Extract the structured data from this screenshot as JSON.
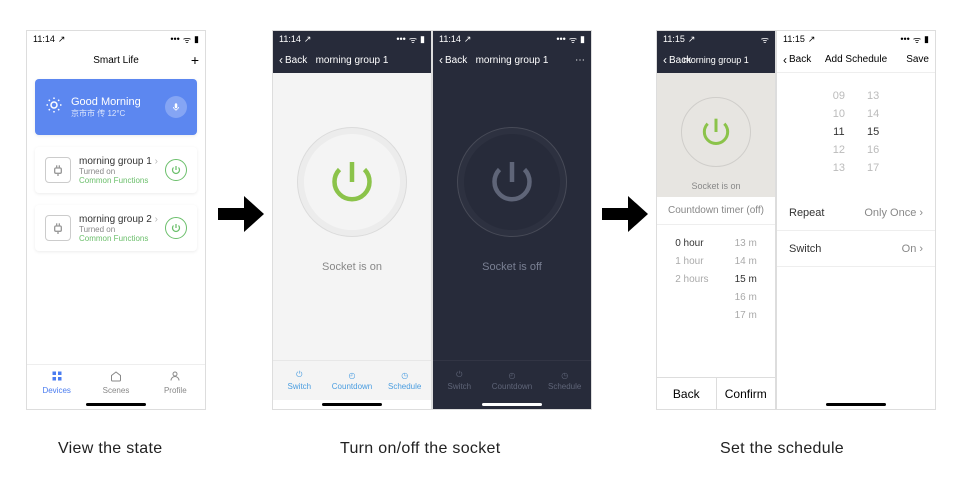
{
  "status_time_a": "11:14",
  "status_time_b": "11:15",
  "stage1": {
    "app_title": "Smart Life",
    "add_icon": "+",
    "weather": {
      "title": "Good Morning",
      "sub": "京市市 传 12°C"
    },
    "devices": [
      {
        "name": "morning group 1",
        "state": "Turned on",
        "extra": "Common Functions"
      },
      {
        "name": "morning group 2",
        "state": "Turned on",
        "extra": "Common Functions"
      }
    ],
    "nav": {
      "devices": "Devices",
      "scenes": "Scenes",
      "profile": "Profile"
    }
  },
  "stage2": {
    "back": "Back",
    "title": "morning group 1",
    "state_on": "Socket is on",
    "state_off": "Socket is off",
    "tabs": {
      "switch": "Switch",
      "countdown": "Countdown",
      "schedule": "Schedule"
    }
  },
  "stage3": {
    "left": {
      "back": "Back",
      "title": "morning group 1",
      "state": "Socket is on",
      "countdown_label": "Countdown timer (off)",
      "hours": [
        "0 hour",
        "1 hour",
        "2 hours"
      ],
      "mins": [
        "13 m",
        "14 m",
        "15 m",
        "16 m",
        "17 m"
      ],
      "sel_hour": "0 hour",
      "sel_min": "15 m",
      "back_btn": "Back",
      "confirm_btn": "Confirm"
    },
    "right": {
      "back": "Back",
      "title": "Add Schedule",
      "save": "Save",
      "hours": [
        "09",
        "10",
        "11",
        "12",
        "13"
      ],
      "mins": [
        "13",
        "14",
        "15",
        "16",
        "17"
      ],
      "sel_hour": "11",
      "sel_min": "15",
      "rows": [
        {
          "label": "Repeat",
          "value": "Only Once"
        },
        {
          "label": "Switch",
          "value": "On"
        }
      ]
    }
  },
  "captions": {
    "c1": "View the state",
    "c2": "Turn on/off the socket",
    "c3": "Set the schedule"
  }
}
